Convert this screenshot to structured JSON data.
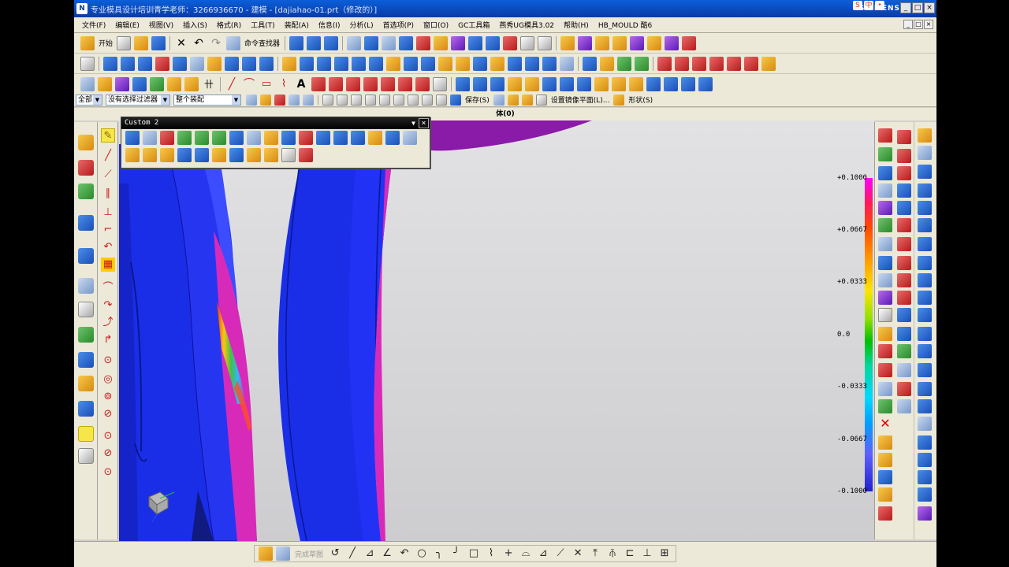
{
  "window": {
    "title": "专业模具设计培训青学老师：3266936670 - 建模 - [dajiahao-01.prt（修改的）]",
    "brand": "SIEMENS",
    "controls": [
      "_",
      "□",
      "×"
    ]
  },
  "menu": {
    "items": [
      "文件(F)",
      "编辑(E)",
      "视图(V)",
      "插入(S)",
      "格式(R)",
      "工具(T)",
      "装配(A)",
      "信息(I)",
      "分析(L)",
      "首选项(P)",
      "窗口(O)",
      "GC工具箱",
      "燕秀UG模具3.02",
      "帮助(H)",
      "HB_MOULD 酷6"
    ],
    "mdi_controls": [
      "_",
      "□",
      "×"
    ]
  },
  "standard_toolbar": {
    "start_label": "开始",
    "command_finder_label": "命令查找器"
  },
  "selection_bar": {
    "filter_all": "全部",
    "type_filter": "没有选择过滤器",
    "scope": "整个装配",
    "save_label": "保存(S)",
    "mirror_plane_label": "设置镜像平面(L)...",
    "shape_label": "形状(S)"
  },
  "viewport": {
    "header": "体(0)"
  },
  "custom_toolbar": {
    "title": "Custom 2"
  },
  "legend": {
    "labels": [
      "+0.1000",
      "+0.0667",
      "+0.0333",
      "0.0",
      "-0.0333",
      "-0.0667",
      "-0.1000"
    ]
  },
  "bottom_toolbar": {
    "finish_sketch_label": "完成草图"
  },
  "colors": {
    "part_blue": "#1a2ee8",
    "part_magenta": "#d82ab8",
    "part_purple": "#8a1aa8",
    "title_blue": "#0a3aa8"
  }
}
